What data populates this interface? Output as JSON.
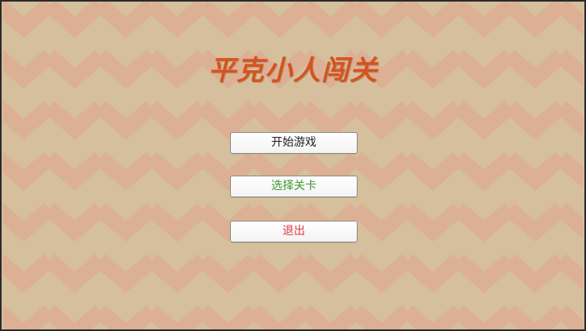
{
  "title": "平克小人闯关",
  "menu": {
    "start_label": "开始游戏",
    "select_level_label": "选择关卡",
    "quit_label": "退出"
  },
  "colors": {
    "background": "#d6bf9c",
    "zigzag": "#dbb095",
    "title": "#d2541e",
    "start_text": "#222222",
    "select_level_text": "#3a9a2a",
    "quit_text": "#e0383b"
  }
}
